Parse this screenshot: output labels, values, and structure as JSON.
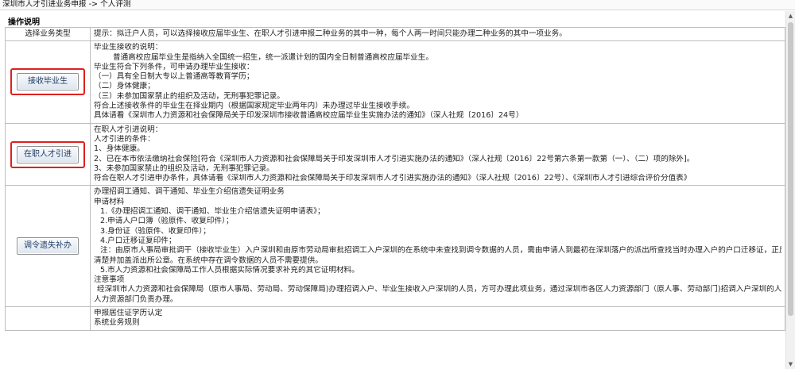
{
  "breadcrumb": "深圳市人才引进业务申报 -> 个人评测",
  "section_title": "操作说明",
  "header": {
    "left": "选择业务类型",
    "right": "提示：拟迁户人员，可以选择接收应届毕业生、在职人才引进申报二种业务的其中一种，每个人两一时间只能办理二种业务的其中一项业务。"
  },
  "rows": [
    {
      "button": "接收毕业生",
      "lines": [
        "毕业生接收的说明：",
        "普通高校应届毕业生是指纳入全国统一招生，统一派遣计划的国内全日制普通高校应届毕业生。",
        "毕业生符合下列条件，可申请办理毕业生接收：",
        "（一）具有全日制大专以上普通高等教育学历；",
        "（二）身体健康；",
        "（三）未参加国家禁止的组织及活动，无刑事犯罪记录。",
        "符合上述接收条件的毕业生在择业期内（根据国家规定毕业两年内）未办理过毕业生接收手续。",
        "具体请看《深圳市人力资源和社会保障局关于印发深圳市接收普通高校应届毕业生实施办法的通知》（深人社规〔2016〕24号）"
      ]
    },
    {
      "button": "在职人才引进",
      "lines": [
        "在职人才引进说明：",
        "人才引进的条件：",
        "1、身体健康。",
        "2、已在本市依法缴纳社会保险[符合《深圳市人力资源和社会保障局关于印发深圳市人才引进实施办法的通知》（深人社规〔2016〕22号第六条第一款第（一）、（二）项的除外]。",
        "3、未参加国家禁止的组织及活动，无刑事犯罪记录。",
        "符合在职人才引进申办条件，具体请看《深圳市人力资源和社会保障局关于印发深圳市人才引进实施办法的通知》（深人社规〔2016〕22号）、《深圳市人才引进综合评价分值表》"
      ]
    },
    {
      "button": "调令遗失补办",
      "lines": [
        "办理招调工通知、调干通知、毕业生介绍信遗失证明业务",
        "申请材料",
        "1.《办理招调工通知、调干通知、毕业生介绍信遗失证明申请表》；",
        "2.申请人户口簿（验原件、收复印件）；",
        "3.身份证（验原件、收复印件）；",
        "4.户口迁移证复印件；",
        "注：由原市人事局审批调干（接收毕业生）入户深圳和由原市劳动局审批招调工入户深圳的在系统中未查找到调令数据的人员，需由申请人到最初在深圳落户的派出所查找当时办理入户的户口迁移证，正反两面复印",
        "清楚并加盖派出所公章。在系统中存在调令数据的人员不需要提供。",
        "5.市人力资源和社会保障局工作人员根据实际情况要求补充的其它证明材料。",
        "注意事项",
        "经深圳市人力资源和社会保障局（原市人事局、劳动局、劳动保障局)办理招调入户、毕业生接收入户深圳的人员，方可办理此项业务，通过深圳市各区人力资源部门（原人事、劳动部门)招调入户深圳的人员由各区",
        "人力资源部门负责办理。"
      ]
    },
    {
      "button": "",
      "lines": [
        "申报居住证学历认定",
        "系统业务规则"
      ]
    }
  ],
  "icons": {
    "scroll_up": "▲",
    "scroll_down": "▼"
  }
}
